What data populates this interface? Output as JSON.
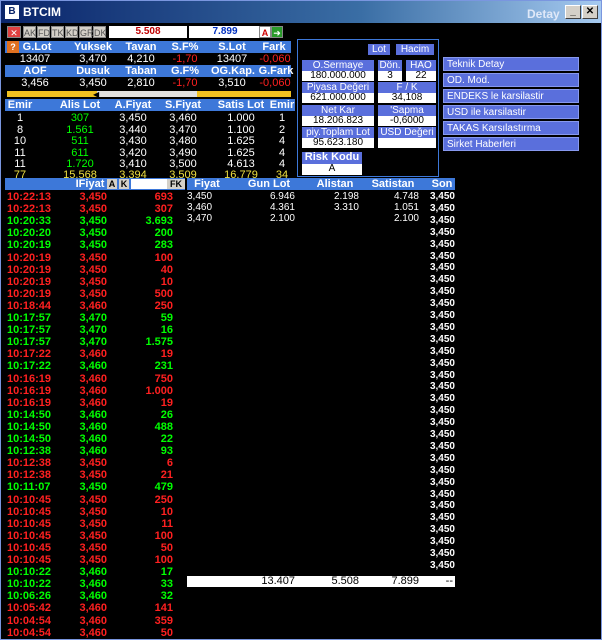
{
  "window": {
    "title": "BTCIM",
    "detay": "Detay"
  },
  "toolbar": {
    "buttons": [
      "AK",
      "FD",
      "TK",
      "KD",
      "GR",
      "DK"
    ],
    "price1": "5.508",
    "price2": "7.899",
    "a_label": "A"
  },
  "summary": {
    "headers1": [
      "G.Lot",
      "Yuksek",
      "Tavan",
      "S.F%",
      "S.Lot",
      "Fark"
    ],
    "values1": [
      "13407",
      "3,470",
      "4,210",
      "-1,70",
      "13407",
      "-0,060"
    ],
    "headers2": [
      "AOF",
      "Dusuk",
      "Taban",
      "G.F%",
      "OG.Kap.",
      "G.Fark"
    ],
    "values2": [
      "3,456",
      "3,450",
      "2,810",
      "-1,70",
      "3,510",
      "-0,060"
    ]
  },
  "depth": {
    "headers": [
      "Emir",
      "Alis Lot",
      "A.Fiyat",
      "S.Fiyat",
      "Satis Lot",
      "Emir"
    ],
    "rows": [
      [
        "1",
        "307",
        "3,450",
        "3,460",
        "1.000",
        "1"
      ],
      [
        "8",
        "1.561",
        "3,440",
        "3,470",
        "1.100",
        "2"
      ],
      [
        "10",
        "511",
        "3,430",
        "3,480",
        "1.625",
        "4"
      ],
      [
        "11",
        "611",
        "3,420",
        "3,490",
        "1.625",
        "4"
      ],
      [
        "11",
        "1.720",
        "3,410",
        "3,500",
        "4.613",
        "4"
      ]
    ],
    "total": [
      "77",
      "15.568",
      "3,394",
      "3,509",
      "16.779",
      "34"
    ]
  },
  "panel": {
    "lot": "Lot",
    "hacim": "Hacim",
    "o_sermaye_label": "O.Sermaye",
    "o_sermaye": "180.000.000",
    "don_label": "Dön.",
    "don": "3",
    "hao_label": "HAO",
    "hao": "22",
    "piyasa_label": "Piyasa Değeri",
    "piyasa": "621.000.000",
    "fk_label": "F / K",
    "fk": "34,108",
    "netkar_label": "Net Kar",
    "netkar": "18.206.823",
    "sapma_label": "'Sapma",
    "sapma": "-0,6000",
    "piy_label": "piy.Toplam Lot",
    "piy": "95.623.180",
    "usd_label": "USD Değeri",
    "usd": "",
    "risk_label": "Risk Kodu",
    "risk": "A"
  },
  "menu": [
    "Teknik Detay",
    "OD. Mod.",
    "ENDEKS le karsilastir",
    "USD ile karsilastir",
    "TAKAS Karsılastırma",
    "Sirket Haberleri"
  ],
  "trades_header": {
    "fiyat": "IFiyat",
    "a": "A",
    "k": "K",
    "fk": "FK"
  },
  "trades": [
    [
      "10:22:13",
      "3,450",
      "693",
      "r"
    ],
    [
      "10:22:13",
      "3,450",
      "307",
      "r"
    ],
    [
      "10:20:33",
      "3,450",
      "3.693",
      "g"
    ],
    [
      "10:20:20",
      "3,450",
      "200",
      "g"
    ],
    [
      "10:20:19",
      "3,450",
      "283",
      "g"
    ],
    [
      "10:20:19",
      "3,450",
      "100",
      "r"
    ],
    [
      "10:20:19",
      "3,450",
      "40",
      "r"
    ],
    [
      "10:20:19",
      "3,450",
      "10",
      "r"
    ],
    [
      "10:20:19",
      "3,450",
      "500",
      "r"
    ],
    [
      "10:18:44",
      "3,460",
      "250",
      "r"
    ],
    [
      "10:17:57",
      "3,470",
      "59",
      "g"
    ],
    [
      "10:17:57",
      "3,470",
      "16",
      "g"
    ],
    [
      "10:17:57",
      "3,470",
      "1.575",
      "g"
    ],
    [
      "10:17:22",
      "3,460",
      "19",
      "r"
    ],
    [
      "10:17:22",
      "3,460",
      "231",
      "g"
    ],
    [
      "10:16:19",
      "3,460",
      "750",
      "r"
    ],
    [
      "10:16:19",
      "3,460",
      "1.000",
      "r"
    ],
    [
      "10:16:19",
      "3,460",
      "19",
      "r"
    ],
    [
      "10:14:50",
      "3,460",
      "26",
      "g"
    ],
    [
      "10:14:50",
      "3,460",
      "488",
      "g"
    ],
    [
      "10:14:50",
      "3,460",
      "22",
      "g"
    ],
    [
      "10:12:38",
      "3,460",
      "93",
      "g"
    ],
    [
      "10:12:38",
      "3,450",
      "6",
      "r"
    ],
    [
      "10:12:38",
      "3,450",
      "21",
      "r"
    ],
    [
      "10:11:07",
      "3,450",
      "479",
      "g"
    ],
    [
      "10:10:45",
      "3,450",
      "250",
      "r"
    ],
    [
      "10:10:45",
      "3,450",
      "10",
      "r"
    ],
    [
      "10:10:45",
      "3,450",
      "11",
      "r"
    ],
    [
      "10:10:45",
      "3,450",
      "100",
      "r"
    ],
    [
      "10:10:45",
      "3,450",
      "50",
      "r"
    ],
    [
      "10:10:45",
      "3,450",
      "100",
      "r"
    ],
    [
      "10:10:22",
      "3,460",
      "17",
      "g"
    ],
    [
      "10:10:22",
      "3,460",
      "33",
      "g"
    ],
    [
      "10:06:26",
      "3,460",
      "32",
      "g"
    ],
    [
      "10:05:42",
      "3,460",
      "141",
      "r"
    ],
    [
      "10:04:54",
      "3,460",
      "359",
      "r"
    ],
    [
      "10:04:54",
      "3,460",
      "50",
      "r"
    ]
  ],
  "volume_header": [
    "Fiyat",
    "Gun Lot",
    "Alistan",
    "Satistan",
    "Son"
  ],
  "volume_rows": [
    [
      "3,450",
      "6.946",
      "2.198",
      "4.748"
    ],
    [
      "3,460",
      "4.361",
      "3.310",
      "1.051"
    ],
    [
      "3,470",
      "2.100",
      "",
      "2.100"
    ]
  ],
  "son_values": [
    "3,450",
    "3,450",
    "3,450",
    "3,450",
    "3,450",
    "3,450",
    "3,450",
    "3,450",
    "3,450",
    "3,450",
    "3,450",
    "3,450",
    "3,450",
    "3,450",
    "3,450",
    "3,450",
    "3,450",
    "3,450",
    "3,450",
    "3,450",
    "3,450",
    "3,450",
    "3,450",
    "3,450",
    "3,450",
    "3,450",
    "3,450",
    "3,450",
    "3,450",
    "3,450",
    "3,450",
    "3,450"
  ],
  "volume_total": [
    "13.407",
    "5.508",
    "7.899",
    "--"
  ],
  "colors": {
    "header": "#3d78d9",
    "buy": "#00ff00",
    "sell": "#ff2020",
    "panel": "#5a6fdc"
  }
}
